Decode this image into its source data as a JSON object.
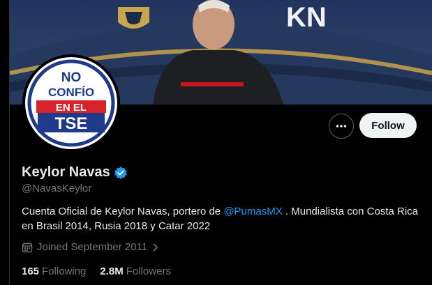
{
  "banner": {
    "logo_text": "KN"
  },
  "avatar": {
    "line1": "NO",
    "line2": "CONFÍO",
    "line3": "EN EL",
    "line4": "TSE"
  },
  "actions": {
    "more_icon": "ellipsis-icon",
    "follow_label": "Follow"
  },
  "profile": {
    "display_name": "Keylor Navas",
    "handle": "@NavasKeylor",
    "bio_before": "Cuenta Oficial de Keylor Navas, portero de ",
    "bio_mention": "@PumasMX",
    "bio_after": " . Mundialista con Costa Rica en Brasil 2014, Rusia 2018 y Catar 2022",
    "joined": "Joined September 2011",
    "verified_color": "#1d9bf0"
  },
  "stats": {
    "following_count": "165",
    "following_label": "Following",
    "followers_count": "2.8M",
    "followers_label": "Followers"
  }
}
